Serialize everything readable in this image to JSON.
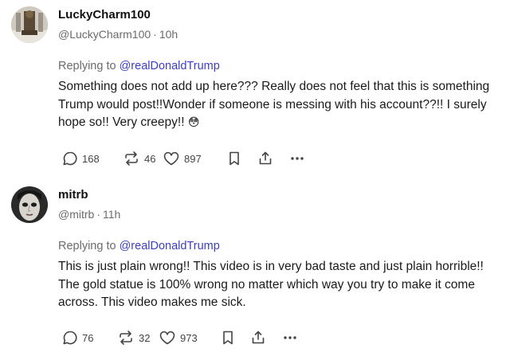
{
  "posts": [
    {
      "author": {
        "name": "LuckyCharm100",
        "handle": "@LuckyCharm100",
        "time": "10h",
        "avatar_icon": "statue-portrait-avatar"
      },
      "reply_prefix": "Replying to",
      "reply_to": "@realDonaldTrump",
      "body": "Something does not add up here??? Really does not feel that this is something Trump would post!!Wonder if someone is messing with his account??!! I surely hope so!! Very creepy!!",
      "body_emoji": "😳",
      "stats": {
        "replies": "168",
        "restacks": "46",
        "likes": "897"
      }
    },
    {
      "author": {
        "name": "mitrb",
        "handle": "@mitrb",
        "time": "11h",
        "avatar_icon": "vintage-face-portrait-avatar"
      },
      "reply_prefix": "Replying to",
      "reply_to": "@realDonaldTrump",
      "body": "This is just plain wrong!! This video is in very bad taste and just plain horrible!! The gold statue is 100% wrong no matter which way you try to make it come across. This video makes me sick.",
      "stats": {
        "replies": "76",
        "restacks": "32",
        "likes": "973"
      }
    }
  ],
  "meta": {
    "separator": "·"
  },
  "icons": {
    "reply": "speech-bubble-icon",
    "restack": "restack-arrows-icon",
    "like": "heart-icon",
    "bookmark": "bookmark-icon",
    "share": "share-icon",
    "more": "more-dots-icon"
  },
  "colors": {
    "mention": "#3b3fc6",
    "muted": "#6b6b6b",
    "text": "#1a1a1a"
  }
}
